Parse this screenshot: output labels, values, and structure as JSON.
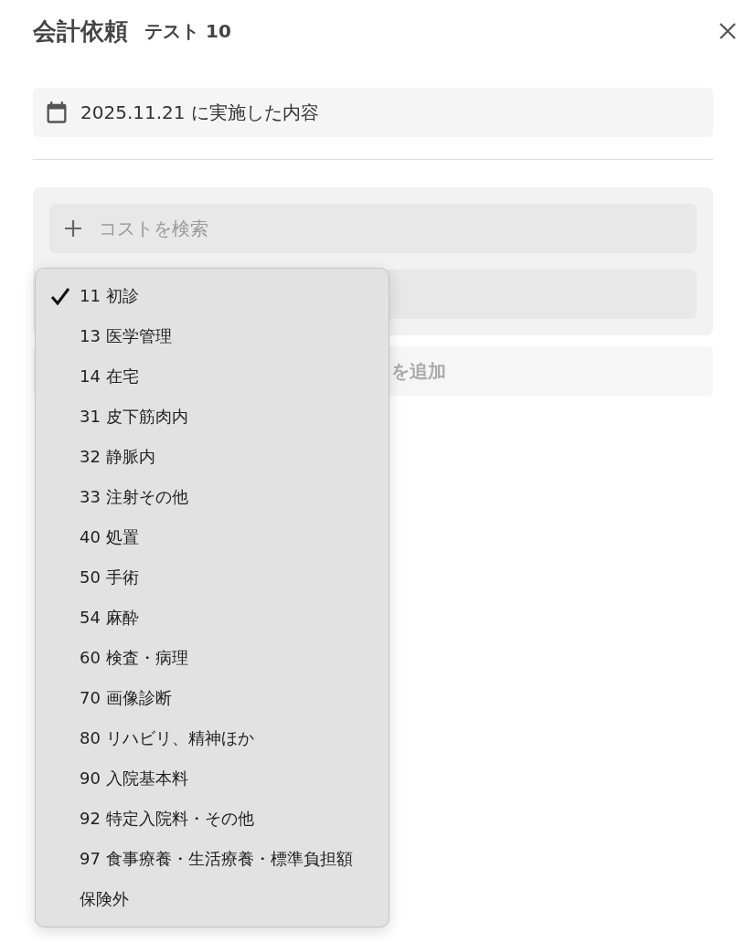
{
  "header": {
    "title": "会計依頼",
    "subtitle": "テスト 10"
  },
  "date_field": {
    "value": "2025.11.21 に実施した内容"
  },
  "cost_panel": {
    "search": {
      "placeholder": "コストを検索"
    }
  },
  "add_button": {
    "label": "を追加",
    "disabled": true
  },
  "category_menu": {
    "items": [
      {
        "label": "11 初診",
        "selected": true
      },
      {
        "label": "13 医学管理",
        "selected": false
      },
      {
        "label": "14 在宅",
        "selected": false
      },
      {
        "label": "31 皮下筋肉内",
        "selected": false
      },
      {
        "label": "32 静脈内",
        "selected": false
      },
      {
        "label": "33 注射その他",
        "selected": false
      },
      {
        "label": "40 処置",
        "selected": false
      },
      {
        "label": "50 手術",
        "selected": false
      },
      {
        "label": "54 麻酔",
        "selected": false
      },
      {
        "label": "60 検査・病理",
        "selected": false
      },
      {
        "label": "70 画像診断",
        "selected": false
      },
      {
        "label": "80 リハビリ、精神ほか",
        "selected": false
      },
      {
        "label": "90 入院基本料",
        "selected": false
      },
      {
        "label": "92 特定入院料・その他",
        "selected": false
      },
      {
        "label": "97 食事療養・生活療養・標準負担額",
        "selected": false
      },
      {
        "label": "保険外",
        "selected": false
      }
    ]
  }
}
